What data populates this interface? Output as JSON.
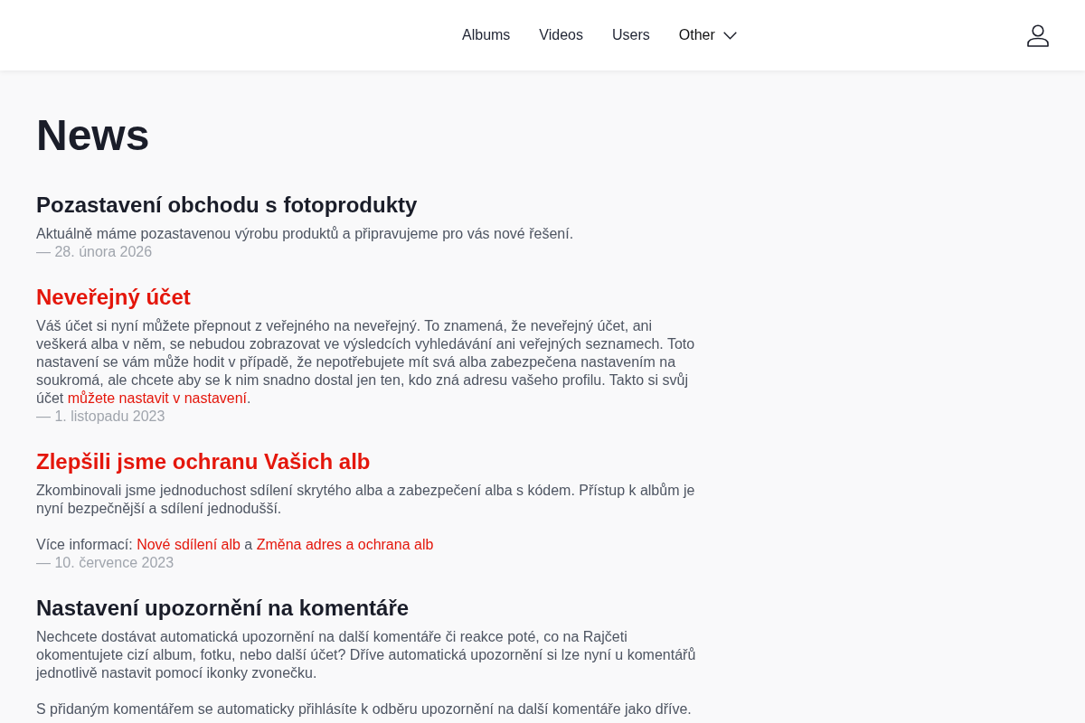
{
  "nav": {
    "items": [
      {
        "label": "Albums",
        "kind": "link"
      },
      {
        "label": "Videos",
        "kind": "link"
      },
      {
        "label": "Users",
        "kind": "link"
      },
      {
        "label": "Other",
        "kind": "dropdown"
      }
    ]
  },
  "page_title": "News",
  "articles": [
    {
      "title": "Pozastavení obchodu s fotoprodukty",
      "title_link": false,
      "paragraphs": [
        [
          {
            "kind": "text",
            "text": "Aktuálně máme pozastavenou výrobu produktů a připravujeme pro vás nové řešení."
          }
        ]
      ],
      "date": "— 28. února 2026"
    },
    {
      "title": "Neveřejný účet",
      "title_link": true,
      "paragraphs": [
        [
          {
            "kind": "text",
            "text": "Váš účet si nyní můžete přepnout z veřejného na neveřejný. To znamená, že neveřejný účet, ani veškerá alba v něm, se nebudou zobrazovat ve výsledcích vyhledávání ani veřejných seznamech. Toto nastavení se vám může hodit v případě, že nepotřebujete mít svá alba zabezpečena nastavením na soukromá, ale chcete aby se k nim snadno dostal jen ten, kdo zná adresu vašeho profilu. Takto si svůj účet "
          },
          {
            "kind": "link",
            "text": "můžete nastavit v nastavení"
          },
          {
            "kind": "text",
            "text": "."
          }
        ]
      ],
      "date": "— 1. listopadu 2023"
    },
    {
      "title": "Zlepšili jsme ochranu Vašich alb",
      "title_link": true,
      "paragraphs": [
        [
          {
            "kind": "text",
            "text": "Zkombinovali jsme jednoduchost sdílení skrytého alba a zabezpečení alba s kódem. Přístup k albům je nyní bezpečnější a sdílení jednodušší."
          }
        ],
        [
          {
            "kind": "text",
            "text": "Více informací: "
          },
          {
            "kind": "link",
            "text": "Nové sdílení alb"
          },
          {
            "kind": "text",
            "text": " a "
          },
          {
            "kind": "link",
            "text": "Změna adres a ochrana alb"
          }
        ]
      ],
      "date": "— 10. července 2023"
    },
    {
      "title": "Nastavení upozornění na komentáře",
      "title_link": false,
      "paragraphs": [
        [
          {
            "kind": "text",
            "text": "Nechcete dostávat automatická upozornění na další komentáře či reakce poté, co na Rajčeti okomentujete cizí album, fotku, nebo další účet? Dříve automatická upozornění si lze nyní u komentářů jednotlivě nastavit pomocí ikonky zvonečku."
          }
        ],
        [
          {
            "kind": "text",
            "text": "S přidaným komentářem se automaticky přihlásíte k odběru upozornění na další komentáře jako dříve."
          }
        ]
      ]
    }
  ]
}
